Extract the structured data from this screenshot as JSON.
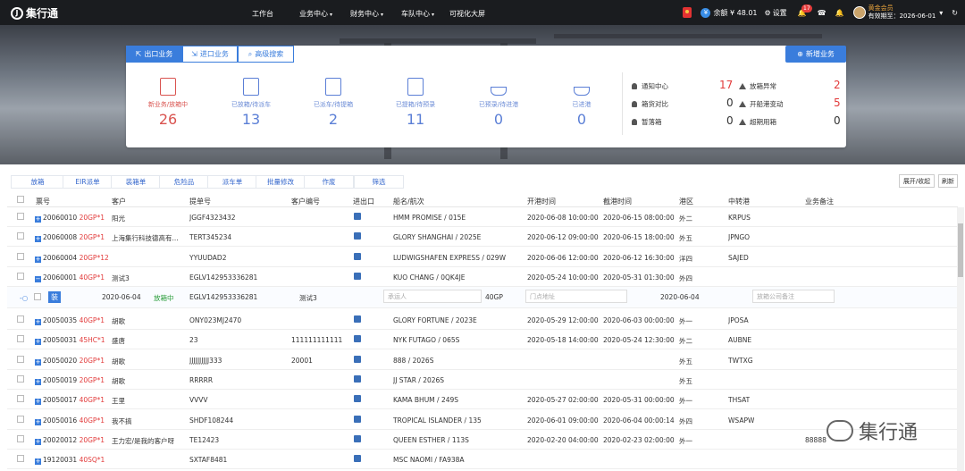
{
  "app": {
    "logo_text": "集行通"
  },
  "nav": [
    "工作台",
    "业务中心",
    "财务中心",
    "车队中心",
    "可视化大屏"
  ],
  "topright": {
    "balance": "余额 ¥ 48.01",
    "settings": "设置",
    "notify_count": "17",
    "vip": "黄金会员",
    "expiry": "有效期至：2026-06-01"
  },
  "tabs": {
    "export": "出口业务",
    "import": "进口业务",
    "search": "高级搜索",
    "new": "新增业务"
  },
  "stats": [
    {
      "label": "新业务/放箱中",
      "value": "26"
    },
    {
      "label": "已放箱/待派车",
      "value": "13"
    },
    {
      "label": "已派车/待提箱",
      "value": "2"
    },
    {
      "label": "已提箱/待预录",
      "value": "11"
    },
    {
      "label": "已预录/待进港",
      "value": "0"
    },
    {
      "label": "已进港",
      "value": "0"
    }
  ],
  "notices": [
    {
      "label": "通知中心",
      "value": "17"
    },
    {
      "label": "箱货对比",
      "value": "0"
    },
    {
      "label": "暂落箱",
      "value": "0"
    },
    {
      "label": "放箱异常",
      "value": "2"
    },
    {
      "label": "开船港变动",
      "value": "5"
    },
    {
      "label": "超期用箱",
      "value": "0"
    }
  ],
  "toolbar": [
    "放箱",
    "EIR派单",
    "装箱单",
    "危险品",
    "派车单",
    "批量修改",
    "作废",
    "筛选"
  ],
  "right_buttons": {
    "expand": "展开/收起",
    "refresh": "刷新"
  },
  "columns": [
    "票号",
    "客户",
    "提单号",
    "客户编号",
    "进出口",
    "船名/航次",
    "开港时间",
    "截港时间",
    "港区",
    "中转港",
    "业务备注"
  ],
  "rows": [
    {
      "id": "20060010",
      "box": "20GP*1",
      "customer": "阳光",
      "bl": "JGGF4323432",
      "cno": "",
      "vessel": "HMM PROMISE / 015E",
      "open": "2020-06-08 10:00:00",
      "cut": "2020-06-15 08:00:00",
      "area": "外二",
      "transit": "KRPUS",
      "note": ""
    },
    {
      "id": "20060008",
      "box": "20GP*1",
      "customer": "上海集行科技德高有...",
      "bl": "TERT345234",
      "cno": "",
      "vessel": "GLORY SHANGHAI / 2025E",
      "open": "2020-06-12 09:00:00",
      "cut": "2020-06-15 18:00:00",
      "area": "外五",
      "transit": "JPNGO",
      "note": ""
    },
    {
      "id": "20060004",
      "box": "20GP*12",
      "customer": "",
      "bl": "YYUUDAD2",
      "cno": "",
      "vessel": "LUDWIGSHAFEN EXPRESS / 029W",
      "open": "2020-06-06 12:00:00",
      "cut": "2020-06-12 16:30:00",
      "area": "洋四",
      "transit": "SAJED",
      "note": ""
    },
    {
      "id": "20060001",
      "box": "40GP*1",
      "customer": "测试3",
      "bl": "EGLV142953336281",
      "cno": "",
      "vessel": "KUO CHANG / 0QK4JE",
      "open": "2020-05-24 10:00:00",
      "cut": "2020-05-31 01:30:00",
      "area": "外四",
      "transit": "",
      "note": ""
    }
  ],
  "expanded": {
    "tag": "装",
    "date": "2020-06-04",
    "status": "放箱中",
    "bl": "EGLV142953336281",
    "customer": "测试3",
    "shipper_ph": "承运人",
    "type": "40GP",
    "addr_ph": "门点地址",
    "date2": "2020-06-04",
    "remark_ph": "放箱公司备注"
  },
  "rows2": [
    {
      "id": "20050035",
      "box": "40GP*1",
      "customer": "胡歌",
      "bl": "ONY023MJ2470",
      "cno": "",
      "vessel": "GLORY FORTUNE / 2023E",
      "open": "2020-05-29 12:00:00",
      "cut": "2020-06-03 00:00:00",
      "area": "外一",
      "transit": "JPOSA",
      "note": ""
    },
    {
      "id": "20050031",
      "box": "45HC*1",
      "customer": "盛唐",
      "bl": "23",
      "cno": "111111111111",
      "vessel": "NYK FUTAGO / 065S",
      "open": "2020-05-18 14:00:00",
      "cut": "2020-05-24 12:30:00",
      "area": "外二",
      "transit": "AUBNE",
      "note": ""
    },
    {
      "id": "20050020",
      "box": "20GP*1",
      "customer": "胡歌",
      "bl": "JJJJJJJJJJ333",
      "cno": "20001",
      "vessel": "888 / 2026S",
      "open": "",
      "cut": "",
      "area": "外五",
      "transit": "TWTXG",
      "note": ""
    },
    {
      "id": "20050019",
      "box": "20GP*1",
      "customer": "胡歌",
      "bl": "RRRRR",
      "cno": "",
      "vessel": "JJ STAR / 2026S",
      "open": "",
      "cut": "",
      "area": "外五",
      "transit": "",
      "note": ""
    },
    {
      "id": "20050017",
      "box": "40GP*1",
      "customer": "王里",
      "bl": "VVVV",
      "cno": "",
      "vessel": "KAMA BHUM / 249S",
      "open": "2020-05-27 02:00:00",
      "cut": "2020-05-31 00:00:00",
      "area": "外一",
      "transit": "THSAT",
      "note": ""
    },
    {
      "id": "20050016",
      "box": "40GP*1",
      "customer": "我不搞",
      "bl": "SHDF108244",
      "cno": "",
      "vessel": "TROPICAL ISLANDER / 135",
      "open": "2020-06-01 09:00:00",
      "cut": "2020-06-04 00:00:14",
      "area": "外四",
      "transit": "WSAPW",
      "note": ""
    },
    {
      "id": "20020012",
      "box": "20GP*1",
      "customer": "王力宏/是我的客户呀",
      "bl": "TE12423",
      "cno": "",
      "vessel": "QUEEN ESTHER / 113S",
      "open": "2020-02-20 04:00:00",
      "cut": "2020-02-23 02:00:00",
      "area": "外一",
      "transit": "",
      "note": "88888"
    },
    {
      "id": "19120031",
      "box": "40SQ*1",
      "customer": "",
      "bl": "SXTAF8481",
      "cno": "",
      "vessel": "MSC NAOMI / FA938A",
      "open": "",
      "cut": "",
      "area": "",
      "transit": "",
      "note": ""
    }
  ],
  "watermark": "集行通"
}
